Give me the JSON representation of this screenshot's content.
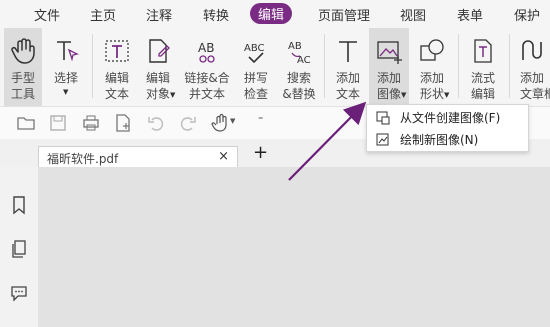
{
  "menu": [
    "文件",
    "主页",
    "注释",
    "转换",
    "编辑",
    "页面管理",
    "视图",
    "表单",
    "保护"
  ],
  "ribbon": [
    {
      "label": "手型\n工具"
    },
    {
      "label": "选择"
    },
    {
      "label": "编辑\n文本"
    },
    {
      "label": "编辑\n对象"
    },
    {
      "label": "链接&合\n并文本"
    },
    {
      "label": "拼写\n检查"
    },
    {
      "label": "搜索\n&替换"
    },
    {
      "label": "添加\n文本"
    },
    {
      "label": "添加\n图像"
    },
    {
      "label": "添加\n形状"
    },
    {
      "label": "流式\n编辑"
    },
    {
      "label": "添加\n文章框"
    }
  ],
  "document_tab": {
    "title": "福昕软件.pdf",
    "close": "×"
  },
  "new_tab": "+",
  "dropdown": [
    {
      "label": "从文件创建图像(F)"
    },
    {
      "label": "绘制新图像(N)"
    }
  ],
  "colors": {
    "accent": "#7a2c84",
    "menu_bg": "#f5f5f5",
    "content_bg": "#e2e2e2"
  }
}
